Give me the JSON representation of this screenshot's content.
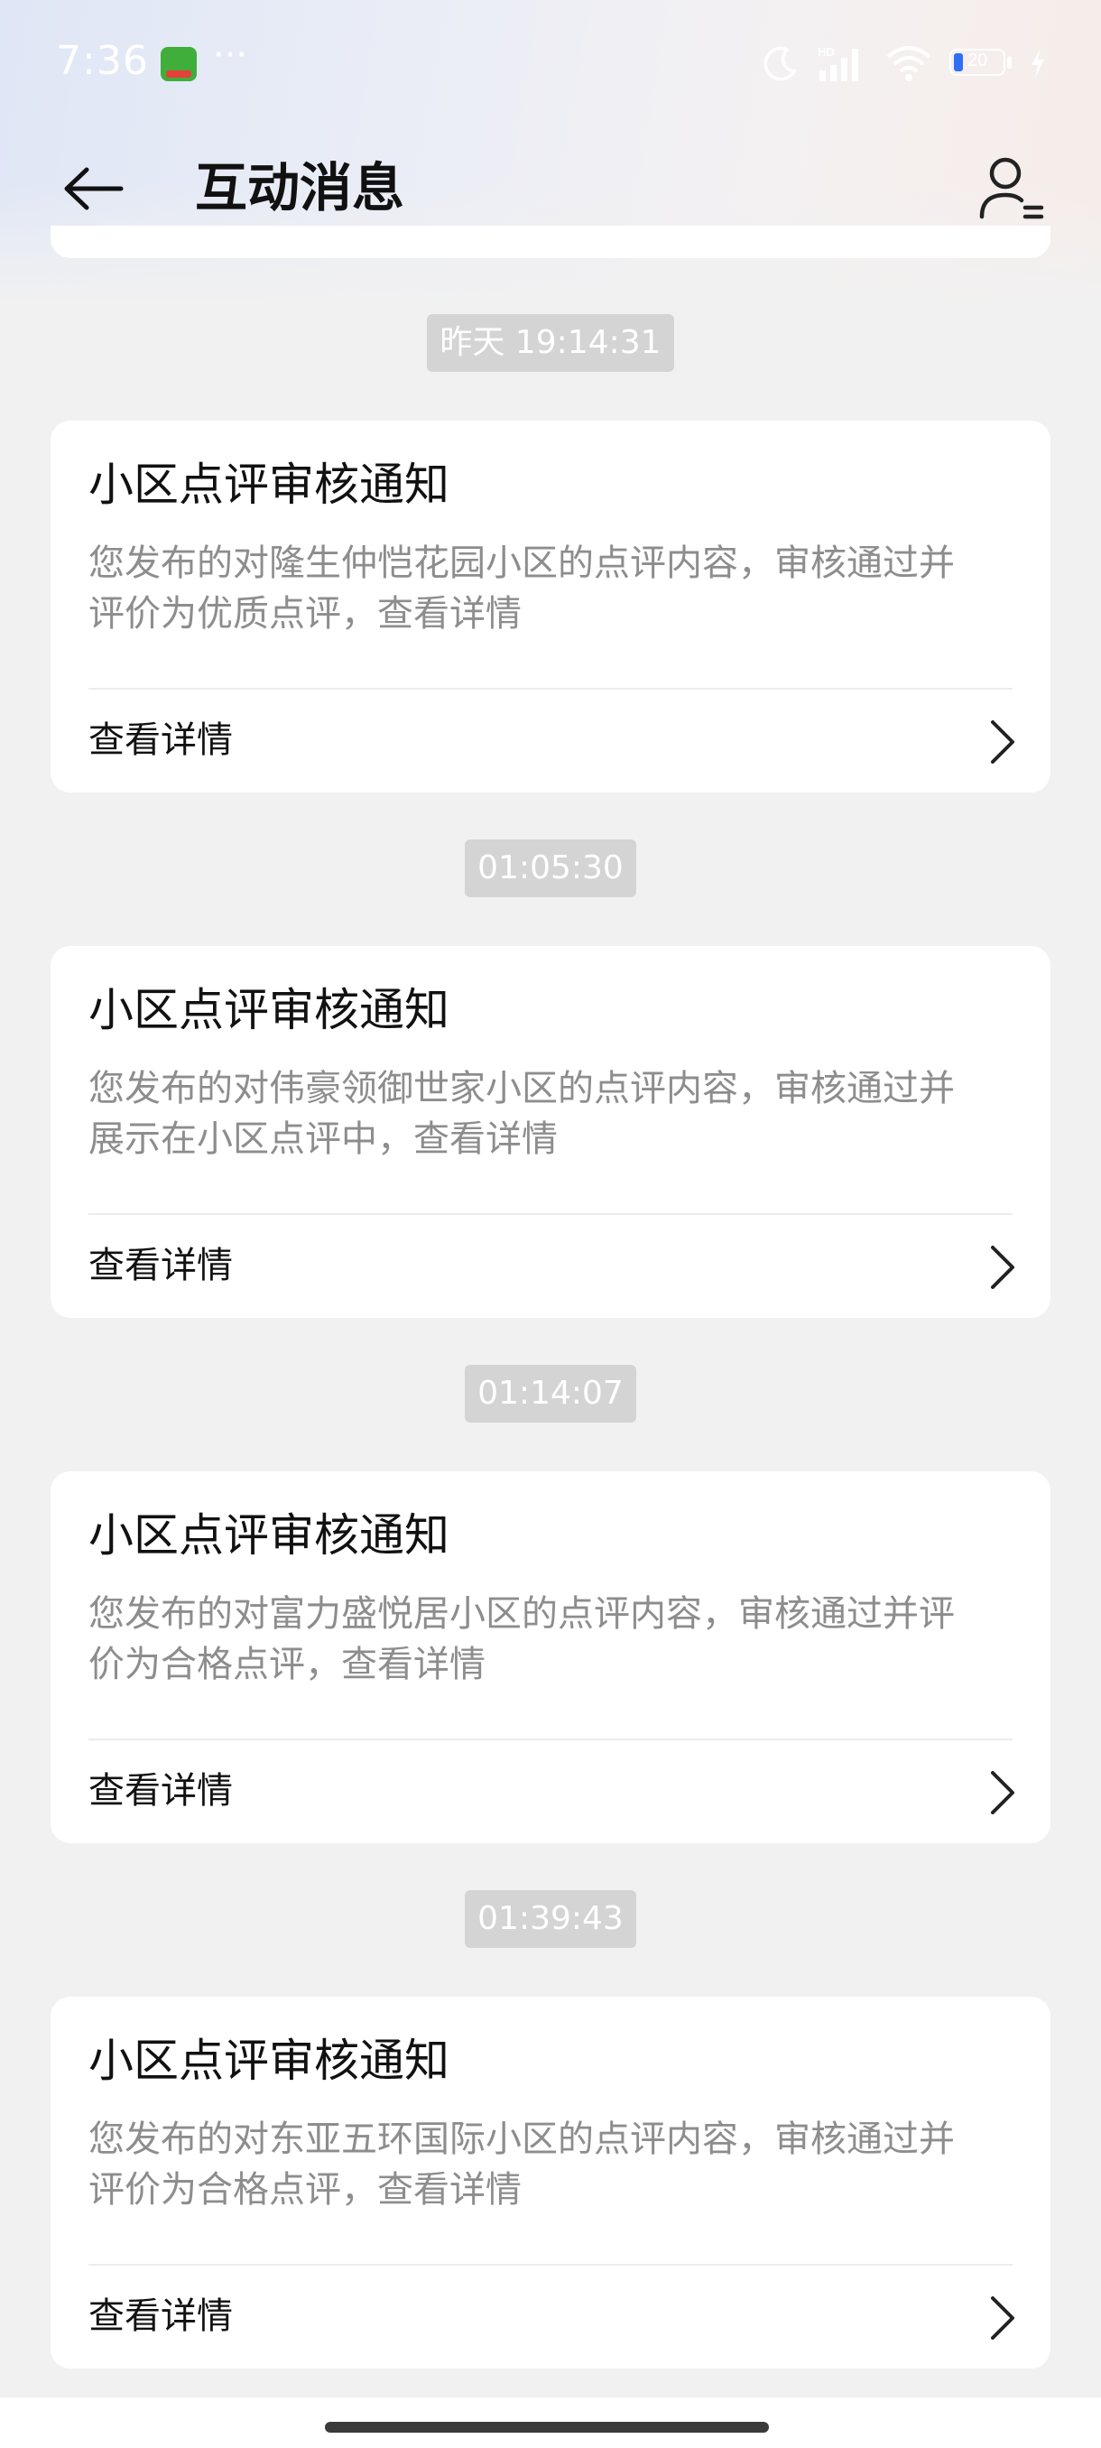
{
  "status_bar": {
    "time": "7:36",
    "more": "···",
    "battery": "20"
  },
  "header": {
    "title": "互动消息"
  },
  "messages": [
    {
      "timestamp": "昨天 19:14:31",
      "title": "小区点评审核通知",
      "body_line1": "您发布的对隆生仲恺花园小区的点评内容，审核通过并",
      "body_line2": "评价为优质点评，查看详情",
      "link": "查看详情"
    },
    {
      "timestamp": "01:05:30",
      "title": "小区点评审核通知",
      "body_line1": "您发布的对伟豪领御世家小区的点评内容，审核通过并",
      "body_line2": "展示在小区点评中，查看详情",
      "link": "查看详情"
    },
    {
      "timestamp": "01:14:07",
      "title": "小区点评审核通知",
      "body_line1": "您发布的对富力盛悦居小区的点评内容，审核通过并评",
      "body_line2": "价为合格点评，查看详情",
      "link": "查看详情"
    },
    {
      "timestamp": "01:39:43",
      "title": "小区点评审核通知",
      "body_line1": "您发布的对东亚五环国际小区的点评内容，审核通过并",
      "body_line2": "评价为合格点评，查看详情",
      "link": "查看详情"
    }
  ]
}
